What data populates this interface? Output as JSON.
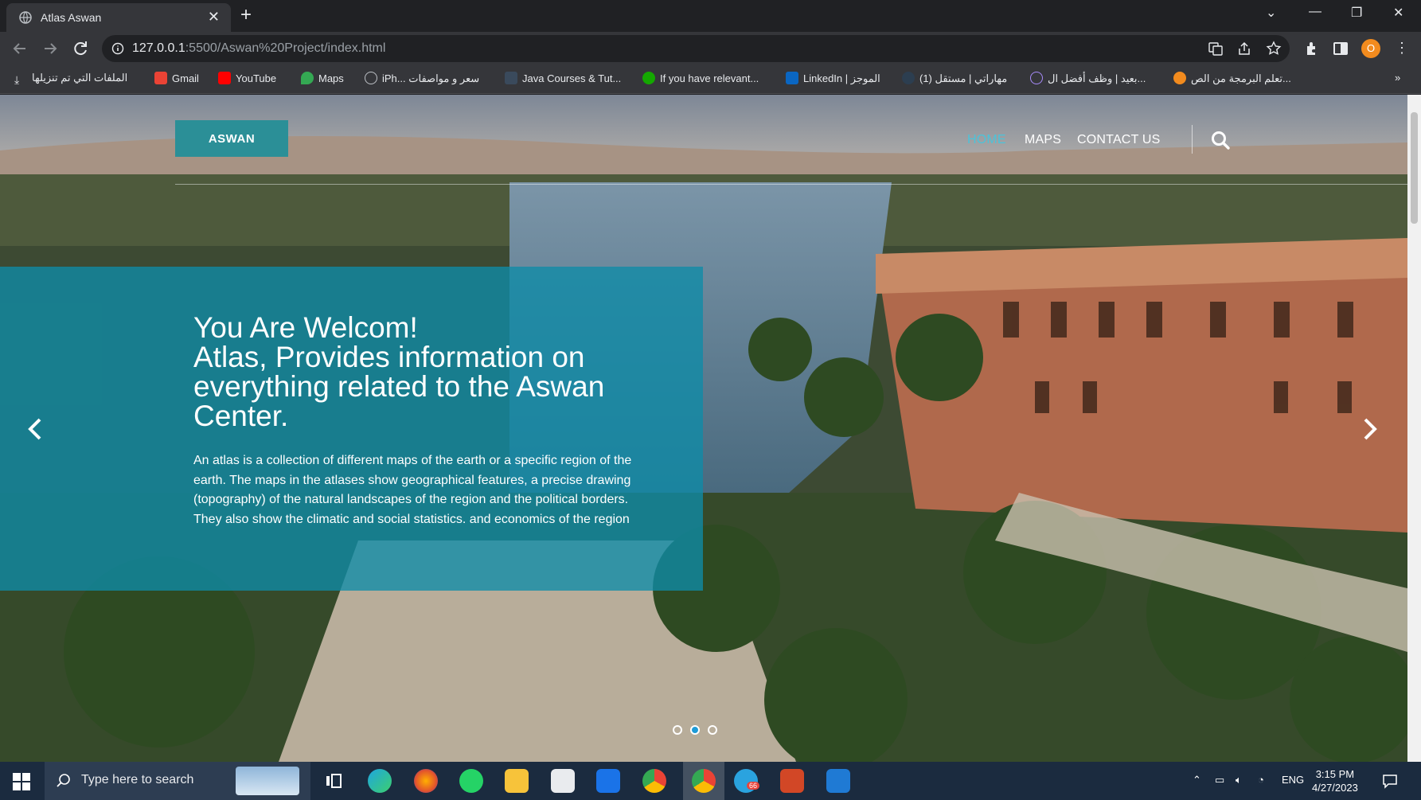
{
  "browser": {
    "tab": {
      "title": "Atlas Aswan",
      "close": "✕"
    },
    "new_tab": "+",
    "window_controls": {
      "dropdown": "⌄",
      "minimize": "—",
      "maximize": "❐",
      "close": "✕"
    },
    "url_host": "127.0.0.1",
    "url_rest": ":5500/Aswan%20Project/index.html",
    "profile_initial": "O",
    "bookmarks": [
      "الملفات التي تم تنزيلها",
      "Gmail",
      "YouTube",
      "Maps",
      "iPh... سعر و مواصفات",
      "Java Courses & Tut...",
      "If you have relevant...",
      "LinkedIn | الموجز",
      "(1) مهاراتي | مستقل",
      "بعيد | وظف أفضل ال...",
      "تعلم البرمجة من الص..."
    ],
    "bookmarks_more": "»"
  },
  "site": {
    "logo": "ASWAN",
    "nav": [
      "HOME",
      "MAPS",
      "CONTACT US"
    ],
    "hero": {
      "heading_line1": "You Are Welcom!",
      "heading_line2": "Atlas, Provides information on everything related to the Aswan Center.",
      "body": "An atlas is a collection of different maps of the earth or a specific region of the earth. The maps in the atlases show geographical features, a precise drawing (topography) of the natural landscapes of the region and the political borders. They also show the climatic and social statistics. and economics of the region",
      "active_slide": 2,
      "slide_count": 3
    }
  },
  "taskbar": {
    "search_placeholder": "Type here to search",
    "language": "ENG",
    "time": "3:15 PM",
    "date": "4/27/2023",
    "telegram_badge": "66"
  },
  "colors": {
    "caption_bg": "#0e8ca8",
    "logo_bg": "#2b8f97",
    "nav_active": "#4cc3d9",
    "taskbar": "#1b2b3f"
  }
}
